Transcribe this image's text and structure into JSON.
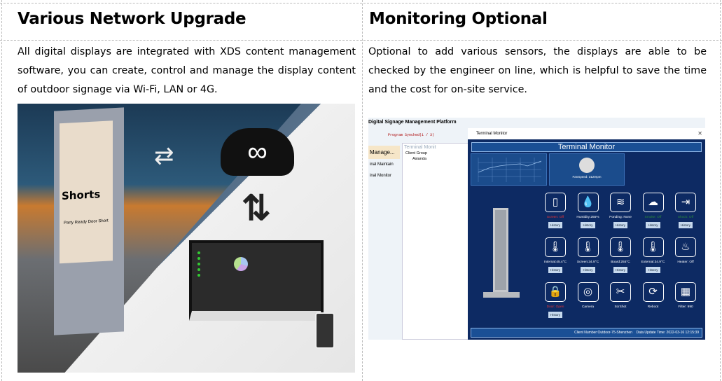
{
  "left": {
    "title": "Various Network Upgrade",
    "text": "All digital displays are integrated with XDS content management software, you can create, control and manage the display content of outdoor signage via Wi-Fi, LAN or 4G.",
    "image": {
      "poster_title": "Shorts",
      "poster_sub": "Party Ready Door Short",
      "icons": [
        "sync-arrows-icon",
        "cloud-infinity-icon",
        "up-down-arrows-icon"
      ]
    }
  },
  "right": {
    "title": "Monitoring Optional",
    "text": "Optional to add various sensors, the displays are able to be checked by the engineer on line, which is helpful to save the time and the cost for on-site service.",
    "screenshot": {
      "platform": "Digital Signage Management Platform",
      "status": "Program Synched(1 / 3)",
      "sidebar": [
        "Manage...",
        "inal Maintain",
        "inal Monitor"
      ],
      "panel_title": "Terminal Monit",
      "client_group_label": "Client Group",
      "client_group_item": "Asianda",
      "window_title": "Terminal Monitor",
      "header": "Terminal Monitor",
      "fan_speed": "FanSpeed: 3120rpm",
      "history_label": "History",
      "sensors": [
        {
          "icon": "screen-icon",
          "label": "Screen: Off",
          "status": "red",
          "history": true
        },
        {
          "icon": "humidity-icon",
          "label": "Humidity:255%",
          "history": true
        },
        {
          "icon": "flood-icon",
          "label": "Ponding: None",
          "history": true
        },
        {
          "icon": "smoke-icon",
          "label": "Smoke: Off",
          "status": "green",
          "history": true
        },
        {
          "icon": "shock-icon",
          "label": "Shock: Off",
          "status": "green",
          "history": true
        },
        {
          "icon": "thermometer-icon",
          "label": "Internal:45.4°C",
          "history": true
        },
        {
          "icon": "thermometer-icon",
          "label": "Screen:34.9°C",
          "history": true
        },
        {
          "icon": "thermometer-icon",
          "label": "Board:255°C",
          "history": true
        },
        {
          "icon": "thermometer-icon",
          "label": "External:34.9°C",
          "history": true
        },
        {
          "icon": "heater-icon",
          "label": "Heater: Off",
          "history": false
        },
        {
          "icon": "door-lock-icon",
          "label": "Door: Open",
          "status": "red",
          "history": true
        },
        {
          "icon": "camera-icon",
          "label": "Camera",
          "history": false
        },
        {
          "icon": "screenshot-icon",
          "label": "ScrShot",
          "history": false
        },
        {
          "icon": "reboot-icon",
          "label": "Reboot",
          "history": false
        },
        {
          "icon": "filter-icon",
          "label": "Filter: 990",
          "history": false
        }
      ],
      "client_number": "Client Number:Outdoor-75-Shenzhen",
      "update_time": "Data Update Time: 2022-03-16 12:15:39"
    }
  },
  "colors": {
    "navy": "#0d2a63",
    "panel": "#1b4c8c"
  }
}
